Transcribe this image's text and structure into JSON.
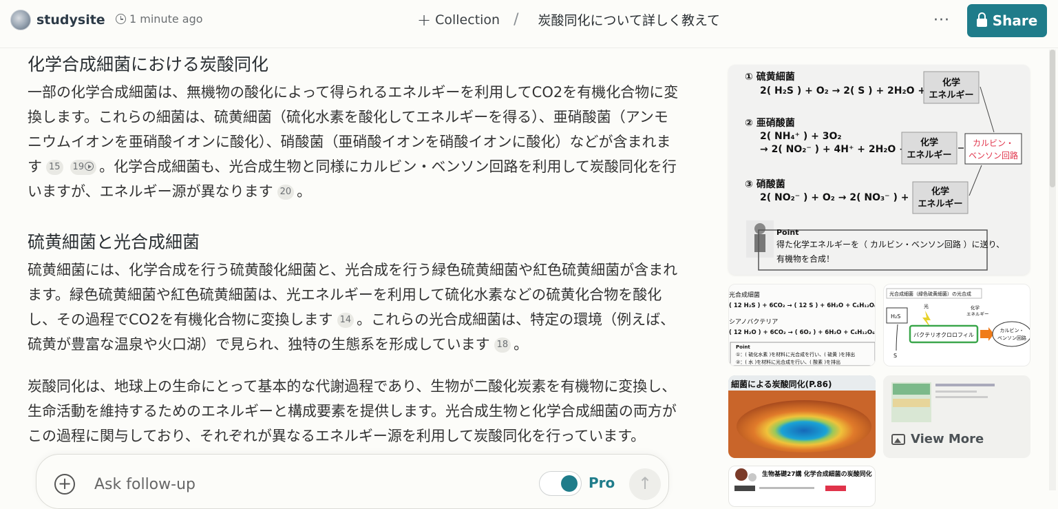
{
  "header": {
    "brand": "studysite",
    "time": "1 minute ago",
    "collection": "Collection",
    "separator": "/",
    "thread_title": "炭酸同化について詳しく教えて",
    "more": "···",
    "share": "Share"
  },
  "article": {
    "section1": {
      "heading": "化学合成細菌における炭酸同化",
      "text_a": "一部の化学合成細菌は、無機物の酸化によって得られるエネルギーを利用してCO2を有機化合物に変換します。これらの細菌は、硫黄細菌（硫化水素を酸化してエネルギーを得る）、亜硝酸菌（アンモニウムイオンを亜硝酸イオンに酸化）、硝酸菌（亜硝酸イオンを硝酸イオンに酸化）などが含まれます",
      "cite_a1": "15",
      "cite_a2": "19",
      "text_b": "。化学合成細菌も、光合成生物と同様にカルビン・ベンソン回路を利用して炭酸同化を行いますが、エネルギー源が異なります",
      "cite_b": "20",
      "text_c": "。"
    },
    "section2": {
      "heading": "硫黄細菌と光合成細菌",
      "text_a": "硫黄細菌には、化学合成を行う硫黄酸化細菌と、光合成を行う緑色硫黄細菌や紅色硫黄細菌が含まれます。緑色硫黄細菌や紅色硫黄細菌は、光エネルギーを利用して硫化水素などの硫黄化合物を酸化し、その過程でCO2を有機化合物に変換します",
      "cite_a": "14",
      "text_b": "。これらの光合成細菌は、特定の環境（例えば、硫黄が豊富な温泉や火口湖）で見られ、独特の生態系を形成しています",
      "cite_b": "18",
      "text_c": "。"
    },
    "section3": {
      "text": "炭酸同化は、地球上の生命にとって基本的な代謝過程であり、生物が二酸化炭素を有機物に変換し、生命活動を維持するためのエネルギーと構成要素を提供します。光合成生物と化学合成細菌の両方がこの過程に関与しており、それぞれが異なるエネルギー源を利用して炭酸同化を行っています。"
    }
  },
  "followup": {
    "placeholder": "Ask follow-up",
    "pro_label": "Pro",
    "submit": "↑",
    "plus": "+"
  },
  "images": {
    "big": {
      "l1": "① 硫黄細菌",
      "l2": "2( H₂S ) + O₂ → 2( S ) + 2H₂O +",
      "l3": "② 亜硝酸菌",
      "l4": "2( NH₄⁺ ) + 3O₂",
      "l5": "→ 2( NO₂⁻ ) + 4H⁺ + 2H₂O +",
      "l6": "③ 硝酸菌",
      "l7": "2( NO₂⁻ ) + O₂ → 2( NO₃⁻ ) +",
      "box_a": "化学",
      "box_b": "エネルギー",
      "calvin_a": "カルビン・",
      "calvin_b": "ベンソン回路",
      "point": "Point",
      "point_l1": "得た化学エネルギーを（ カルビン・ベンソン回路 ）に送り、",
      "point_l2": "有機物を合成！"
    },
    "t1": {
      "l1": "光合成細菌",
      "l2": "( 12 H₂S ) + 6CO₂ → ( 12 S ) + 6H₂O + C₆H₁₂O₆",
      "l3": "シアノバクテリア",
      "l4": "( 12 H₂O ) + 6CO₂ → ( 6O₂ ) + 6H₂O + C₆H₁₂O₆",
      "l5": "Point",
      "l6": "①：( 硫化水素 )を材料に光合成を行い、( 硫黄 )を排出",
      "l7": "②：( 水 )を材料に光合成を行い、( 酸素 )を排出"
    },
    "t2": {
      "title": "光合成細菌（緑色硫黄細菌）の光合成",
      "light": "光",
      "chem_a": "化学",
      "chem_b": "エネルギー",
      "h2s": "H₂S",
      "s": "S",
      "bchl": "バクテリオクロロフィル",
      "calvin_a": "カルビン・",
      "calvin_b": "ベンソン回路"
    },
    "t3": {
      "caption": "細菌による炭酸同化(P.86)"
    },
    "t4": {
      "view_more": "View More"
    },
    "t5": {
      "title": "生物基礎27講 化学合成細菌の炭酸同化"
    }
  },
  "colors": {
    "accent": "#1f7c8a",
    "red_annotation": "#e0334a",
    "green_box": "#3aa64b",
    "orange_arrow": "#f07c1a"
  }
}
